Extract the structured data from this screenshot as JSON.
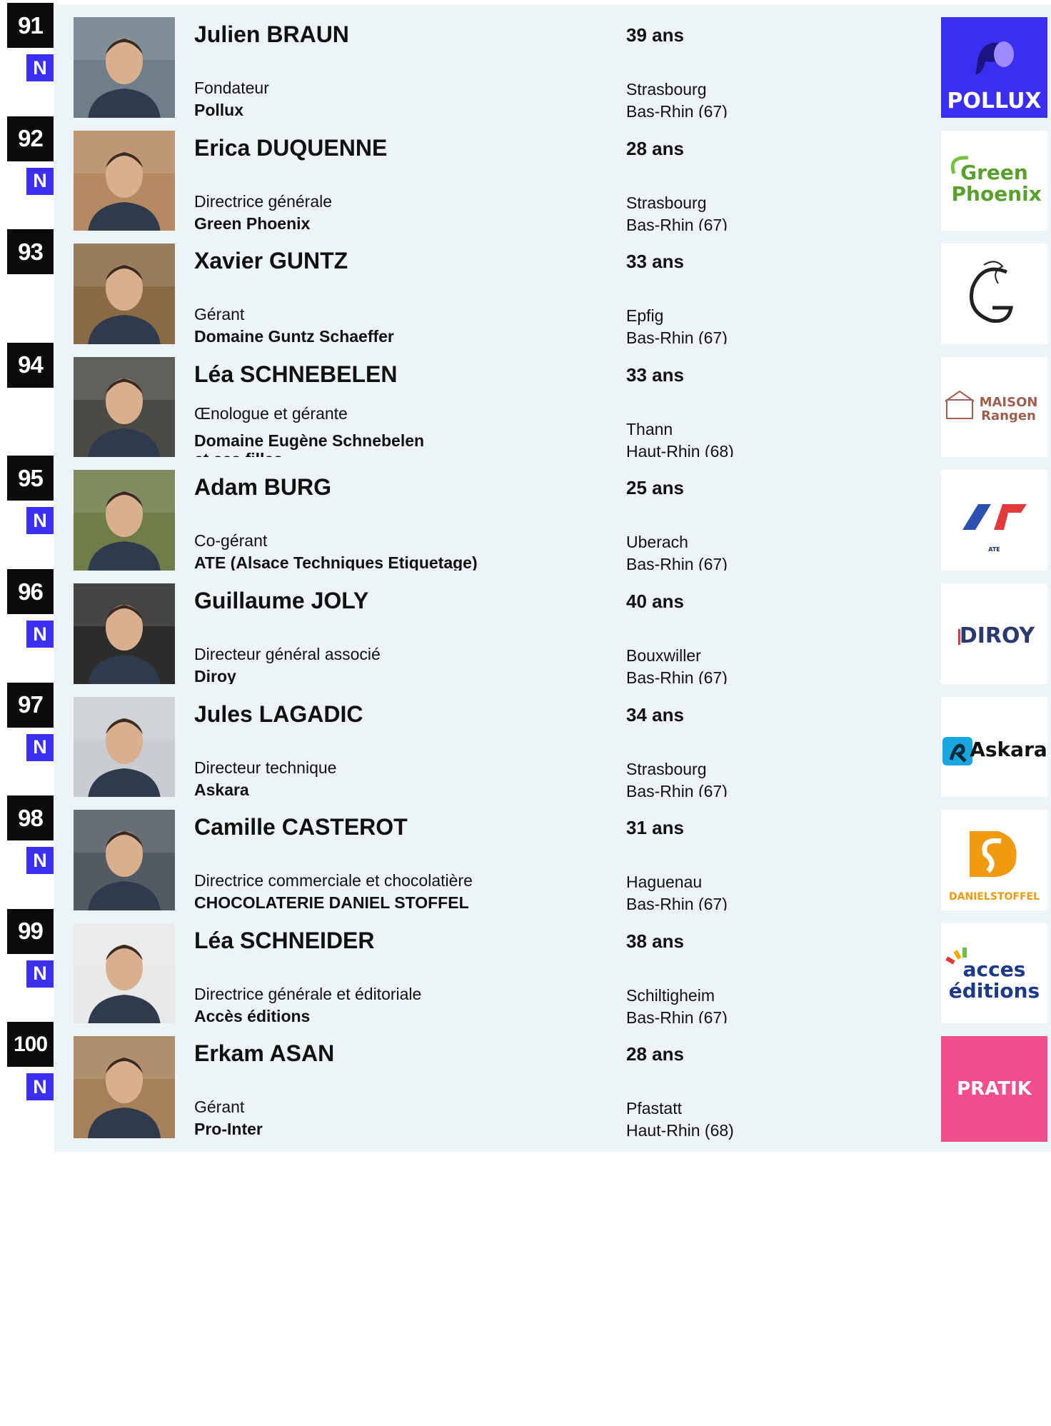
{
  "entries": [
    {
      "rank": "91",
      "badge": "N",
      "name": "Julien BRAUN",
      "role": "Fondateur",
      "company": "Pollux",
      "age": "39 ans",
      "city": "Strasbourg",
      "dept": "Bas-Rhin (67)",
      "logo_text": "POLLUX",
      "logo_icon": "pollux-logo",
      "photo_bg": "#6f7f8a",
      "accent": "#3a2ff0"
    },
    {
      "rank": "92",
      "badge": "N",
      "name": "Erica DUQUENNE",
      "role": "Directrice générale",
      "company": "Green Phoenix",
      "age": "28 ans",
      "city": "Strasbourg",
      "dept": "Bas-Rhin (67)",
      "logo_text": "Green Phoenix",
      "logo_icon": "green-phoenix-logo",
      "photo_bg": "#b58a63",
      "accent": "#5aa02c"
    },
    {
      "rank": "93",
      "badge": "",
      "name": "Xavier GUNTZ",
      "role": "Gérant",
      "company": "Domaine Guntz Schaeffer",
      "age": "33 ans",
      "city": "Epfig",
      "dept": "Bas-Rhin (67)",
      "logo_text": "G",
      "logo_icon": "monogram-g-logo",
      "photo_bg": "#8a6a45",
      "accent": "#222222"
    },
    {
      "rank": "94",
      "badge": "",
      "name": "Léa SCHNEBELEN",
      "role": "Œnologue et gérante",
      "company": "Domaine Eugène Schnebelen\net ses filles",
      "age": "33 ans",
      "city": "Thann",
      "dept": "Haut-Rhin (68)",
      "logo_text": "MAISON Rangen",
      "logo_icon": "maison-rangen-logo",
      "photo_bg": "#4b4a44",
      "accent": "#a0604f"
    },
    {
      "rank": "95",
      "badge": "N",
      "name": "Adam BURG",
      "role": "Co-gérant",
      "company": "ATE (Alsace Techniques Etiquetage)",
      "age": "25 ans",
      "city": "Uberach",
      "dept": "Bas-Rhin (67)",
      "logo_text": "ATE",
      "logo_icon": "ate-logo",
      "photo_bg": "#6e7d4a",
      "accent": "#e23a3a"
    },
    {
      "rank": "96",
      "badge": "N",
      "name": "Guillaume JOLY",
      "role": "Directeur général associé",
      "company": "Diroy",
      "age": "40 ans",
      "city": "Bouxwiller",
      "dept": "Bas-Rhin (67)",
      "logo_text": "DIROY",
      "logo_icon": "diroy-logo",
      "photo_bg": "#2c2c2c",
      "accent": "#2a3a6e"
    },
    {
      "rank": "97",
      "badge": "N",
      "name": "Jules LAGADIC",
      "role": "Directeur technique",
      "company": "Askara",
      "age": "34 ans",
      "city": "Strasbourg",
      "dept": "Bas-Rhin (67)",
      "logo_text": "Askara",
      "logo_icon": "askara-logo",
      "photo_bg": "#c9cdd2",
      "accent": "#1aa6e0"
    },
    {
      "rank": "98",
      "badge": "N",
      "name": "Camille CASTEROT",
      "role": "Directrice commerciale et chocolatière",
      "company": "CHOCOLATERIE DANIEL STOFFEL",
      "age": "31 ans",
      "city": "Haguenau",
      "dept": "Bas-Rhin (67)",
      "logo_text": "DANIELSTOFFEL",
      "logo_icon": "daniel-stoffel-logo",
      "photo_bg": "#525a63",
      "accent": "#ef9a10"
    },
    {
      "rank": "99",
      "badge": "N",
      "name": "Léa SCHNEIDER",
      "role": "Directrice générale et éditoriale",
      "company": "Accès éditions",
      "age": "38 ans",
      "city": "Schiltigheim",
      "dept": "Bas-Rhin (67)",
      "logo_text": "acces éditions",
      "logo_icon": "acces-editions-logo",
      "photo_bg": "#e9e9e9",
      "accent": "#1d3a8a"
    },
    {
      "rank": "100",
      "badge": "N",
      "name": "Erkam ASAN",
      "role": "Gérant",
      "company": "Pro-Inter",
      "age": "28 ans",
      "city": "Pfastatt",
      "dept": "Haut-Rhin (68)",
      "logo_text": "PRATIK",
      "logo_icon": "pratik-logo",
      "photo_bg": "#a5805a",
      "accent": "#f04e8c"
    }
  ]
}
